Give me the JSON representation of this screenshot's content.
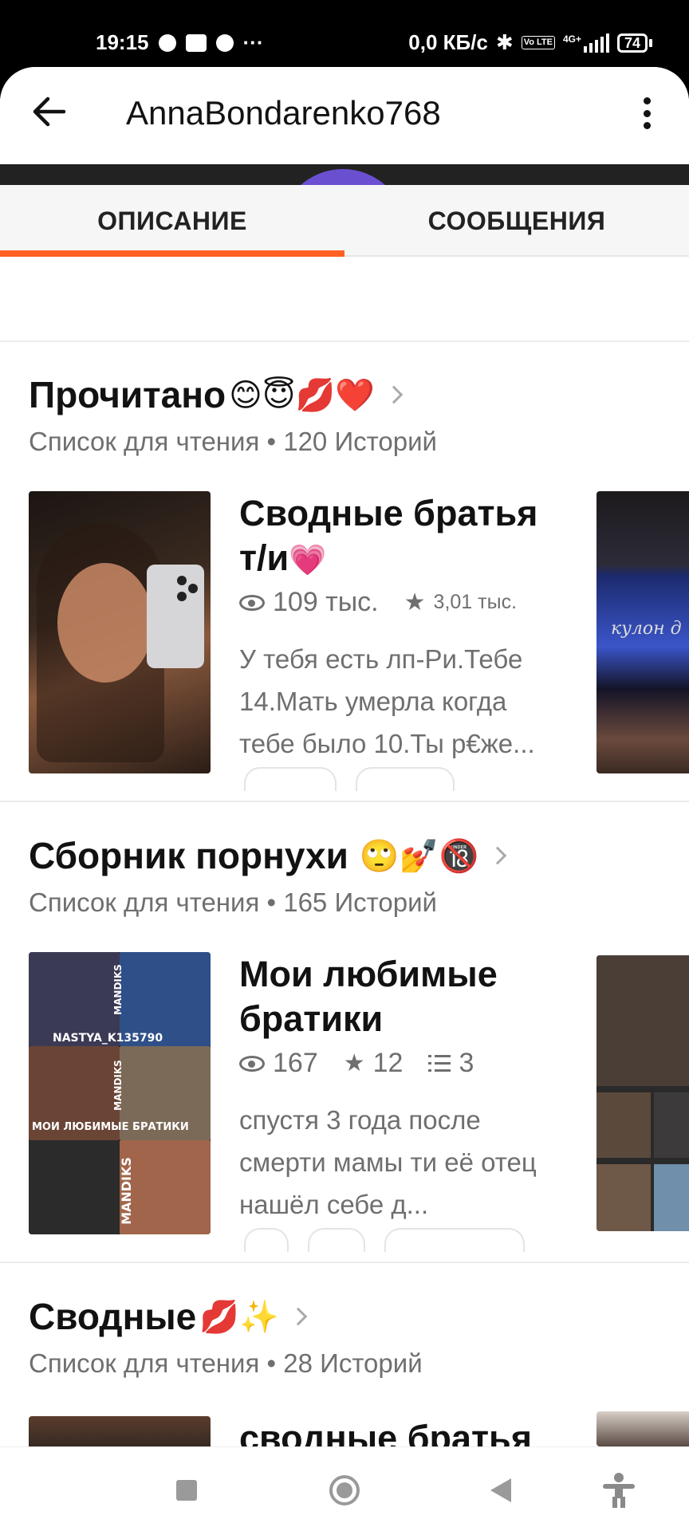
{
  "status_bar": {
    "time": "19:15",
    "dots": "···",
    "network_speed": "0,0 КБ/с",
    "volte": "Vo LTE",
    "network_type": "4G+",
    "battery": "74"
  },
  "header": {
    "title": "AnnaBondarenko768"
  },
  "tabs": [
    {
      "label": "ОПИСАНИЕ",
      "active": true
    },
    {
      "label": "СООБЩЕНИЯ",
      "active": false
    }
  ],
  "accent_color": "#ff6122",
  "reading_lists": [
    {
      "title": "Прочитано",
      "emoji": "😊😇💋❤️",
      "subtitle": "Список для чтения • 120 Историй",
      "story": {
        "title": "Сводные братья т/и",
        "title_emoji": "💗",
        "views": "109 тыс.",
        "votes": "3,01 тыс.",
        "description": "У тебя есть лп-Ри.Тебе 14.Мать умерла когда тебе было 10.Ты р€же..."
      },
      "side_cover_caption": "кулон д"
    },
    {
      "title": "Сборник порнухи",
      "emoji": "🙄💅🔞",
      "subtitle": "Список для чтения • 165 Историй",
      "story": {
        "title": "Мои любимые братики",
        "views": "167",
        "votes": "12",
        "parts": "3",
        "description": "спустя 3 года после смерти мамы ти её отец нашёл себе д...",
        "cover_texts": [
          "NASTYA_K135790",
          "MANDIKS",
          "MANDIKS",
          "МОИ ЛЮБИМЫЕ БРАТИКИ",
          "MANDIKS",
          "MANDIKS"
        ]
      }
    },
    {
      "title": "Сводные",
      "emoji": "💋✨",
      "subtitle": "Список для чтения • 28 Историй",
      "story": {
        "title": "сводные братья"
      }
    }
  ]
}
